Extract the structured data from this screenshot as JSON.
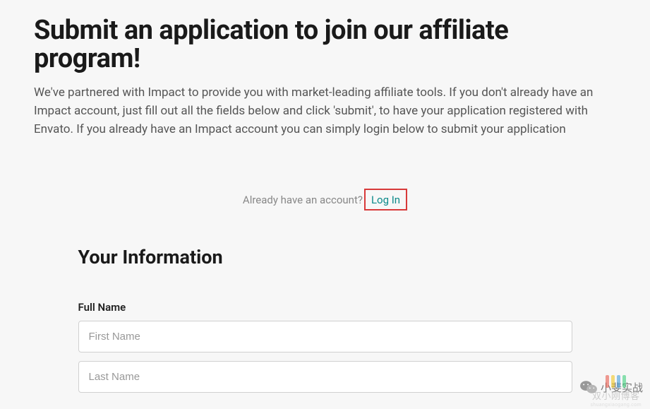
{
  "header": {
    "title": "Submit an application to join our affiliate program!",
    "description": "We've partnered with Impact to provide you with market-leading affiliate tools. If you don't already have an Impact account, just fill out all the fields below and click 'submit', to have your application registered with Envato. If you already have an Impact account you can simply login below to submit your application"
  },
  "login": {
    "prompt_text": "Already have an account?",
    "link_text": "Log In"
  },
  "form": {
    "section_heading": "Your Information",
    "full_name_label": "Full Name",
    "first_name_placeholder": "First Name",
    "last_name_placeholder": "Last Name"
  },
  "watermark": {
    "wechat_text": "小斐实战",
    "blog_main": "双小刚博客",
    "blog_sub": "shuangxiaogang.com"
  }
}
